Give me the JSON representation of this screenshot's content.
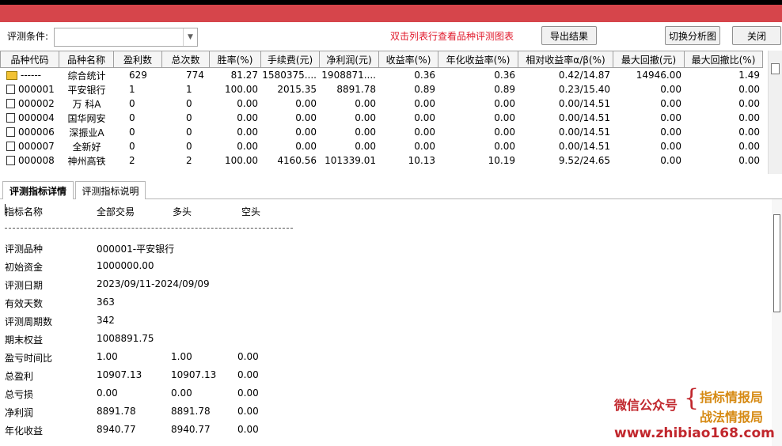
{
  "toolbar": {
    "condition_label": "评测条件:",
    "condition_value": "",
    "hint": "双击列表行查看品种评测图表",
    "export_label": "导出结果",
    "switch_label": "切换分析图",
    "close_label": "关闭"
  },
  "table": {
    "columns": [
      "品种代码",
      "品种名称",
      "盈利数",
      "总次数",
      "胜率(%)",
      "手续费(元)",
      "净利润(元)",
      "收益率(%)",
      "年化收益率(%)",
      "相对收益率α/β(%)",
      "最大回撤(元)",
      "最大回撤比(%)"
    ],
    "rows": [
      {
        "icon": "folder-icon",
        "code": "------",
        "name": "综合统计",
        "wins": "629",
        "total": "774",
        "winrate": "81.27",
        "fee": "1580375....",
        "profit": "1908871....",
        "ret": "0.36",
        "annual": "0.36",
        "alpha": "0.42/14.87",
        "dd": "14946.00",
        "ddr": "1.49"
      },
      {
        "icon": "document-icon",
        "code": "000001",
        "name": "平安银行",
        "wins": "1",
        "total": "1",
        "winrate": "100.00",
        "fee": "2015.35",
        "profit": "8891.78",
        "ret": "0.89",
        "annual": "0.89",
        "alpha": "0.23/15.40",
        "dd": "0.00",
        "ddr": "0.00"
      },
      {
        "icon": "document-icon",
        "code": "000002",
        "name": "万 科A",
        "wins": "0",
        "total": "0",
        "winrate": "0.00",
        "fee": "0.00",
        "profit": "0.00",
        "ret": "0.00",
        "annual": "0.00",
        "alpha": "0.00/14.51",
        "dd": "0.00",
        "ddr": "0.00"
      },
      {
        "icon": "document-icon",
        "code": "000004",
        "name": "国华网安",
        "wins": "0",
        "total": "0",
        "winrate": "0.00",
        "fee": "0.00",
        "profit": "0.00",
        "ret": "0.00",
        "annual": "0.00",
        "alpha": "0.00/14.51",
        "dd": "0.00",
        "ddr": "0.00"
      },
      {
        "icon": "document-icon",
        "code": "000006",
        "name": "深振业A",
        "wins": "0",
        "total": "0",
        "winrate": "0.00",
        "fee": "0.00",
        "profit": "0.00",
        "ret": "0.00",
        "annual": "0.00",
        "alpha": "0.00/14.51",
        "dd": "0.00",
        "ddr": "0.00"
      },
      {
        "icon": "document-icon",
        "code": "000007",
        "name": "全新好",
        "wins": "0",
        "total": "0",
        "winrate": "0.00",
        "fee": "0.00",
        "profit": "0.00",
        "ret": "0.00",
        "annual": "0.00",
        "alpha": "0.00/14.51",
        "dd": "0.00",
        "ddr": "0.00"
      },
      {
        "icon": "document-icon",
        "code": "000008",
        "name": "神州高铁",
        "wins": "2",
        "total": "2",
        "winrate": "100.00",
        "fee": "4160.56",
        "profit": "101339.01",
        "ret": "10.13",
        "annual": "10.19",
        "alpha": "9.52/24.65",
        "dd": "0.00",
        "ddr": "0.00"
      }
    ]
  },
  "tabs": [
    {
      "label": "评测指标详情",
      "active": true
    },
    {
      "label": "评测指标说明",
      "active": false
    }
  ],
  "detail": {
    "header": {
      "name": "指标名称",
      "all": "全部交易",
      "long": "多头",
      "short": "空头"
    },
    "separator": "--------------------------------------------------------------------------------",
    "rows": [
      {
        "label": "评测品种",
        "v1": "000001-平安银行",
        "v2": "",
        "v3": ""
      },
      {
        "label": "初始资金",
        "v1": "1000000.00",
        "v2": "",
        "v3": ""
      },
      {
        "label": "评测日期",
        "v1": "2023/09/11-2024/09/09",
        "v2": "",
        "v3": ""
      },
      {
        "label": "有效天数",
        "v1": "363",
        "v2": "",
        "v3": ""
      },
      {
        "label": "评测周期数",
        "v1": "342",
        "v2": "",
        "v3": ""
      },
      {
        "label": "期末权益",
        "v1": "1008891.75",
        "v2": "",
        "v3": ""
      },
      {
        "label": "盈亏时间比",
        "v1": "1.00",
        "v2": "1.00",
        "v3": "0.00"
      },
      {
        "label": "总盈利",
        "v1": "10907.13",
        "v2": "10907.13",
        "v3": "0.00"
      },
      {
        "label": "总亏损",
        "v1": "0.00",
        "v2": "0.00",
        "v3": "0.00"
      },
      {
        "label": "净利润",
        "v1": "8891.78",
        "v2": "8891.78",
        "v3": "0.00"
      },
      {
        "label": "年化收益",
        "v1": "8940.77",
        "v2": "8940.77",
        "v3": "0.00"
      }
    ]
  },
  "watermark": {
    "wechat": "微信公众号",
    "brace": "{",
    "name1": "指标情报局",
    "name2": "战法情报局",
    "url": "www.zhibiao168.com"
  }
}
